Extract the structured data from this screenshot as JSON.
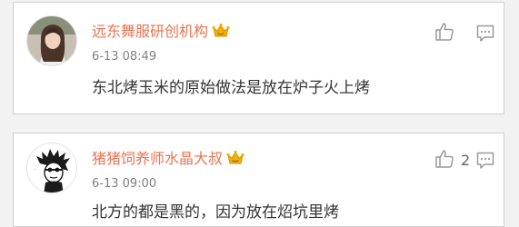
{
  "comments": [
    {
      "username": "远东舞服研创机构",
      "time": "6-13 08:49",
      "text": "东北烤玉米的原始做法是放在炉子火上烤",
      "likes": ""
    },
    {
      "username": "猪猪饲养师水晶大叔",
      "time": "6-13 09:00",
      "text": "北方的都是黑的，因为放在炤坑里烤",
      "likes": "2"
    }
  ],
  "colors": {
    "username": "#eb7350",
    "crown": "#f5b000",
    "icon": "#999999"
  },
  "icons": [
    "user-avatar",
    "vip-crown-icon",
    "thumbs-up-icon",
    "comment-bubble-icon"
  ]
}
